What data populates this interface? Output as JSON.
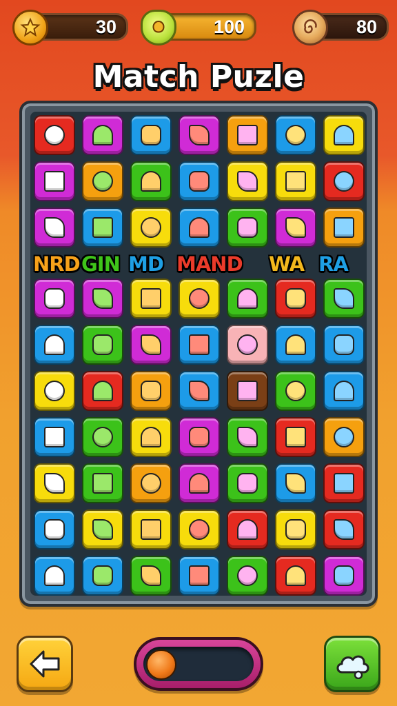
{
  "resources": {
    "coins": {
      "value": "30",
      "icon": "star-coin-icon",
      "color": "#f0a318"
    },
    "gems": {
      "value": "100",
      "icon": "gem-icon",
      "color": "#b8e03a"
    },
    "candy": {
      "value": "80",
      "icon": "swirl-candy-icon",
      "color": "#e5a85a"
    }
  },
  "title": "Match Puzle",
  "board": {
    "columns": 7,
    "rows": [
      [
        "red:apple",
        "magenta:shield",
        "blue:heart",
        "magenta:sun",
        "orange:carrot",
        "blue:lollipop",
        "yellow:toolbox"
      ],
      [
        "magenta:pencil",
        "orange:amulet",
        "green:leaf",
        "blue:dice",
        "yellow:bean",
        "yellow:bone",
        "red:pepper"
      ],
      [
        "magenta:milk",
        "blue:racket",
        "yellow:bagel",
        "blue:hammer",
        "green:pencil",
        "magenta:grapes",
        "orange:bucket"
      ],
      [
        "magenta:cake",
        "magenta:cheese",
        "yellow:onion",
        "yellow:cloud",
        "green:carrot",
        "red:dragon",
        "green:plum"
      ],
      [
        "blue:chick",
        "green:pudding",
        "magenta:crossbones",
        "blue:crayon",
        "pink:donut",
        "blue:ring",
        "blue:roller"
      ],
      [
        "yellow:puzzle",
        "red:emblem",
        "orange:rolling-pin",
        "blue:yarn",
        "brown:donut",
        "green:croissant",
        "blue:cupcake"
      ],
      [
        "blue:crayon",
        "green:mushroom",
        "yellow:donut",
        "magenta:sun",
        "green:spiral",
        "red:gear",
        "orange:balloon"
      ],
      [
        "yellow:donut",
        "green:duck",
        "orange:sprout",
        "magenta:tomato",
        "green:balloon",
        "blue:pencil",
        "red:gem"
      ],
      [
        "blue:pencil",
        "yellow:bottle",
        "yellow:crayon",
        "yellow:cinnamon-roll",
        "red:umbrella",
        "yellow:cloud",
        "red:coin"
      ],
      [
        "blue:lemon",
        "blue:bow",
        "green:star",
        "blue:stick",
        "green:heart",
        "red:cheese",
        "magenta:box"
      ]
    ],
    "word_row": [
      {
        "text": "NRD",
        "color": "#f6a21a"
      },
      {
        "text": "GIN",
        "color": "#3fc41a"
      },
      {
        "text": "MD",
        "color": "#1e9fe4"
      },
      {
        "text": "MAND",
        "color": "#ea3b2a"
      },
      {
        "text": "WA",
        "color": "#f3b81c"
      },
      {
        "text": "RA",
        "color": "#1e9fe4"
      }
    ]
  },
  "tile_colors": {
    "red": "#e52a20",
    "magenta": "#d02bd6",
    "blue": "#1d9be8",
    "orange": "#f5a00f",
    "yellow": "#f7dc0c",
    "green": "#3cc21a",
    "pink": "#f8b3b6",
    "brown": "#7a3f16"
  },
  "controls": {
    "back_icon": "arrow-left-icon",
    "hint_icon": "cloud-hint-icon",
    "slider_position": 0.0
  }
}
